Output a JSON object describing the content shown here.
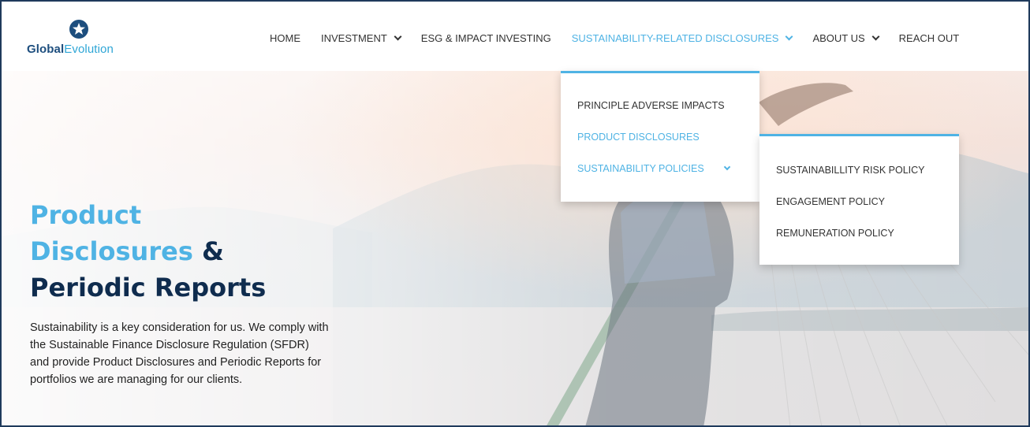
{
  "brand": {
    "logo_prefix": "Global",
    "logo_suffix": "Evolution",
    "logo_icon": "star-circle-icon",
    "primary_color": "#1d4e7e",
    "accent_color": "#4fb3e4"
  },
  "nav": {
    "items": [
      {
        "label": "HOME",
        "has_dropdown": false,
        "active": false
      },
      {
        "label": "INVESTMENT",
        "has_dropdown": true,
        "active": false
      },
      {
        "label": "ESG & IMPACT INVESTING",
        "has_dropdown": false,
        "active": false
      },
      {
        "label": "SUSTAINABILITY-RELATED DISCLOSURES",
        "has_dropdown": true,
        "active": true
      },
      {
        "label": "ABOUT US",
        "has_dropdown": true,
        "active": false
      },
      {
        "label": "REACH OUT",
        "has_dropdown": false,
        "active": false
      }
    ]
  },
  "dropdown": {
    "items": [
      {
        "label": "PRINCIPLE ADVERSE IMPACTS",
        "active": false
      },
      {
        "label": "PRODUCT DISCLOSURES",
        "active": true
      },
      {
        "label": "SUSTAINABILITY POLICIES",
        "active": true,
        "has_submenu": true
      }
    ]
  },
  "subdropdown": {
    "items": [
      {
        "label": "SUSTAINABILLITY RISK POLICY"
      },
      {
        "label": "ENGAGEMENT POLICY"
      },
      {
        "label": "REMUNERATION POLICY"
      }
    ]
  },
  "hero": {
    "title_line1": "Product",
    "title_line2a": "Disclosures",
    "title_line2b": " &",
    "title_line3": "Periodic Reports",
    "body": "Sustainability is a key consideration for us. We comply with the Sustainable Finance Disclosure Regulation (SFDR) and provide Product Disclosures and Periodic Reports for portfolios we are managing for our clients."
  }
}
